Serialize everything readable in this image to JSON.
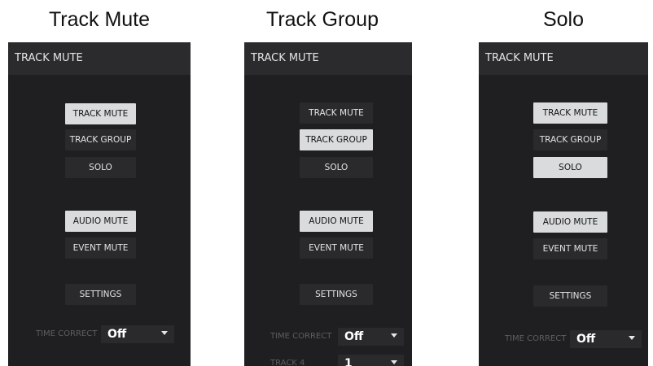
{
  "captions": [
    "Track Mute",
    "Track Group",
    "Solo"
  ],
  "panels": [
    {
      "header": "TRACK MUTE",
      "mode_buttons": [
        {
          "label": "TRACK MUTE",
          "active": true
        },
        {
          "label": "TRACK GROUP",
          "active": false
        },
        {
          "label": "SOLO",
          "active": false
        }
      ],
      "type_buttons": [
        {
          "label": "AUDIO MUTE",
          "active": true
        },
        {
          "label": "EVENT MUTE",
          "active": false
        }
      ],
      "settings_label": "SETTINGS",
      "rows": [
        {
          "label": "TIME CORRECT",
          "value": "Off"
        }
      ]
    },
    {
      "header": "TRACK MUTE",
      "mode_buttons": [
        {
          "label": "TRACK MUTE",
          "active": false
        },
        {
          "label": "TRACK GROUP",
          "active": true
        },
        {
          "label": "SOLO",
          "active": false
        }
      ],
      "type_buttons": [
        {
          "label": "AUDIO MUTE",
          "active": true
        },
        {
          "label": "EVENT MUTE",
          "active": false
        }
      ],
      "settings_label": "SETTINGS",
      "rows": [
        {
          "label": "TIME CORRECT",
          "value": "Off"
        },
        {
          "label": "TRACK 4",
          "value": "1"
        }
      ]
    },
    {
      "header": "TRACK MUTE",
      "mode_buttons": [
        {
          "label": "TRACK MUTE",
          "active": true
        },
        {
          "label": "TRACK GROUP",
          "active": false
        },
        {
          "label": "SOLO",
          "active": true
        }
      ],
      "type_buttons": [
        {
          "label": "AUDIO MUTE",
          "active": true
        },
        {
          "label": "EVENT MUTE",
          "active": false
        }
      ],
      "settings_label": "SETTINGS",
      "rows": [
        {
          "label": "TIME CORRECT",
          "value": "Off"
        }
      ]
    }
  ]
}
